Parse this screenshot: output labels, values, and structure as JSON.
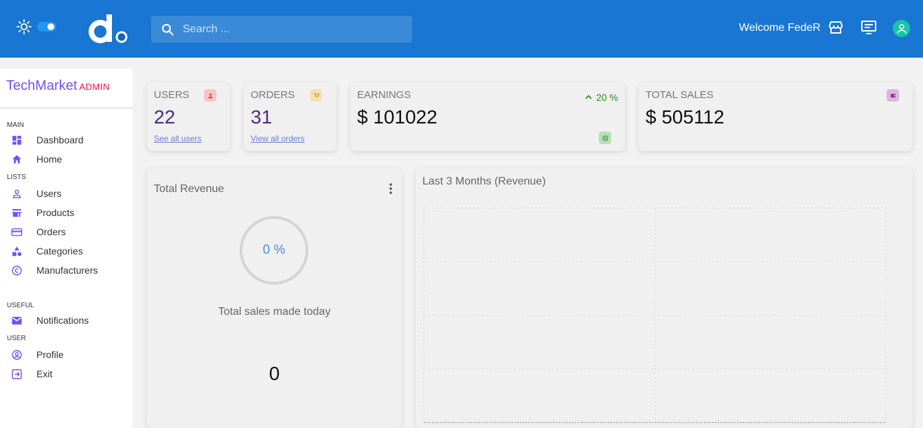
{
  "search": {
    "placeholder": "Search ..."
  },
  "topbar": {
    "welcome": "Welcome FedeR"
  },
  "sidebar": {
    "brand": "TechMarket",
    "brand_sub": "ADMIN",
    "sections": {
      "main": "MAIN",
      "lists": "LISTS",
      "useful": "USEFUL",
      "user": "USER"
    },
    "items": {
      "dashboard": "Dashboard",
      "home": "Home",
      "users": "Users",
      "products": "Products",
      "orders": "Orders",
      "categories": "Categories",
      "manufacturers": "Manufacturers",
      "notifications": "Notifications",
      "profile": "Profile",
      "exit": "Exit"
    }
  },
  "widgets": {
    "users": {
      "title": "USERS",
      "value": "22",
      "link": "See all users"
    },
    "orders": {
      "title": "ORDERS",
      "value": "31",
      "link": "View all orders"
    },
    "earnings": {
      "title": "EARNINGS",
      "value": "$ 101022",
      "percent": "20 %"
    },
    "total_sales": {
      "title": "TOTAL SALES",
      "value": "$ 505112"
    }
  },
  "featured": {
    "title": "Total Revenue",
    "progress_label": "0 %",
    "progress": 0,
    "subtitle": "Total sales made today",
    "amount": "0"
  },
  "chart_data": {
    "type": "area",
    "title": "Last 3 Months (Revenue)",
    "categories": [],
    "values": [],
    "grid": true
  },
  "colors": {
    "topbar": "#1976d2",
    "brand": "#7451f8",
    "brand_sub": "#ff0844",
    "accent": "#7451f8"
  }
}
